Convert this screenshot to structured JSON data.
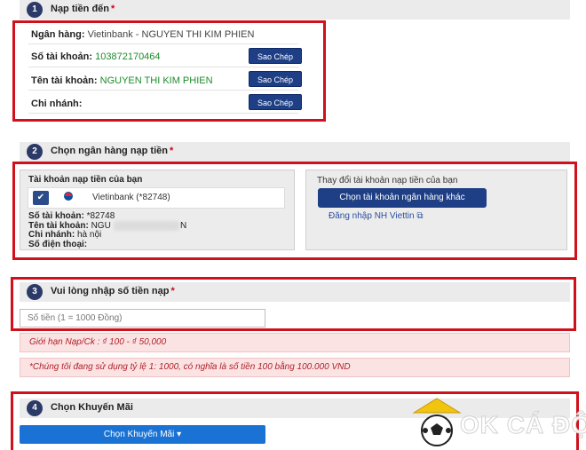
{
  "section1": {
    "num": "1",
    "title": "Nạp tiền đến",
    "req": "*",
    "bank_label": "Ngân hàng:",
    "bank_value": "Vietinbank - NGUYEN THI KIM PHIEN",
    "account_label": "Số tài khoản:",
    "account_value": "103872170464",
    "name_label": "Tên tài khoản:",
    "name_value": "NGUYEN THI KIM PHIEN",
    "branch_label": "Chi nhánh:",
    "copy_label": "Sao Chép"
  },
  "section2": {
    "num": "2",
    "title": "Chọn ngân hàng nạp tiền",
    "req": "*",
    "left_title": "Tài khoản nạp tiền của bạn",
    "bank_option": "Vietinbank (*82748)",
    "logo_text": "VietinBank",
    "account_label": "Số tài khoản:",
    "account_value": "*82748",
    "name_label": "Tên tài khoản:",
    "name_value_start": "NGU",
    "name_value_end": "N",
    "branch_label": "Chi nhánh:",
    "branch_value": "hà nội",
    "phone_label": "Số điện thoại:",
    "right_title": "Thay đổi tài khoản nạp tiền của bạn",
    "choose_button": "Chọn tài khoản ngân hàng khác",
    "login_link": "Đăng nhập NH Viettin",
    "checkbox_icon": "✔",
    "external_icon": "⧉"
  },
  "section3": {
    "num": "3",
    "title": "Vui lòng nhập số tiền nạp",
    "req": "*",
    "amount_placeholder": "Số tiền (1 = 1000 Đồng)",
    "limit_note": "Giới hạn Nạp/Ck : ₫ 100 - ₫ 50,000",
    "rate_note": "*Chúng tôi đang sử dụng tỷ lệ 1: 1000, có nghĩa là số tiền 100 bằng 100.000 VND"
  },
  "section4": {
    "num": "4",
    "title": "Chọn Khuyến Mãi",
    "promo_button": "Chọn Khuyến Mãi ▾"
  },
  "watermark": {
    "text": "OK CÁ ĐỘ"
  },
  "colors": {
    "primary_button": "#1e3f86",
    "promo_button": "#1a73d4",
    "highlight_border": "#d0101a",
    "green_value": "#1d8c2a"
  }
}
